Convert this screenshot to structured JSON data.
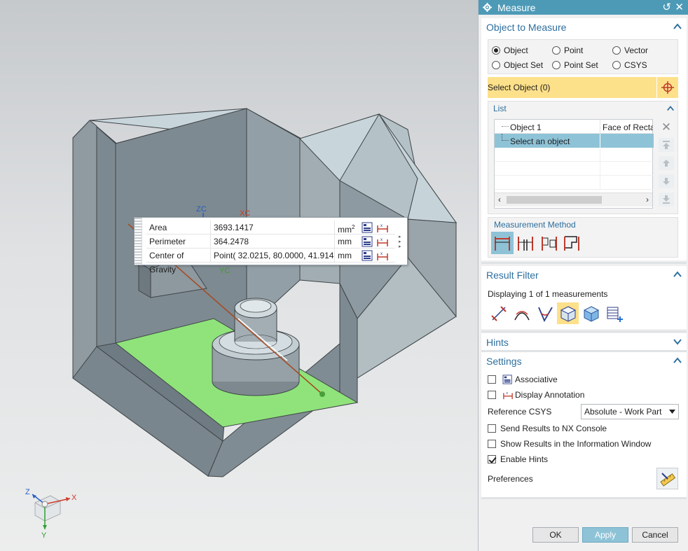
{
  "viewport": {
    "popup": {
      "rows": [
        {
          "label": "Area",
          "value": "3693.1417",
          "unit": "mm",
          "unit_sup": "2"
        },
        {
          "label": "Perimeter",
          "value": "364.2478",
          "unit": "mm",
          "unit_sup": ""
        },
        {
          "label": "Center of Gravity",
          "value": "Point( 32.0215, 80.0000, 41.9140)",
          "unit": "mm",
          "unit_sup": ""
        }
      ]
    },
    "axis_labels": {
      "zc": "ZC",
      "xc": "XC",
      "yc": "YC"
    },
    "triad": {
      "x": "X",
      "y": "Y",
      "z": "Z"
    },
    "colors": {
      "face_highlight": "#8fe37a",
      "part": "#8a969e",
      "part_top": "#c8d6dc"
    }
  },
  "dialog": {
    "title": "Measure",
    "object_to_measure": {
      "header": "Object to Measure",
      "options": [
        {
          "label": "Object",
          "selected": true
        },
        {
          "label": "Point",
          "selected": false
        },
        {
          "label": "Vector",
          "selected": false
        },
        {
          "label": "Object Set",
          "selected": false
        },
        {
          "label": "Point Set",
          "selected": false
        },
        {
          "label": "CSYS",
          "selected": false
        }
      ],
      "select_label": "Select Object (0)",
      "list": {
        "header": "List",
        "rows": [
          {
            "name": "Object 1",
            "type": "Face of Recta"
          },
          {
            "name": "Select an object",
            "type": ""
          }
        ]
      },
      "method_label": "Measurement Method"
    },
    "result_filter": {
      "header": "Result Filter",
      "displaying": "Displaying 1 of 1 measurements"
    },
    "hints": {
      "header": "Hints"
    },
    "settings": {
      "header": "Settings",
      "associative": "Associative",
      "display_annotation": "Display Annotation",
      "reference_csys_label": "Reference CSYS",
      "reference_csys_value": "Absolute - Work Part",
      "send_results": "Send Results to NX Console",
      "show_results": "Show Results in the Information Window",
      "enable_hints": "Enable Hints",
      "preferences": "Preferences"
    },
    "buttons": {
      "ok": "OK",
      "apply": "Apply",
      "cancel": "Cancel"
    },
    "accent": "#4d9ab7",
    "select_highlight": "#fde08a"
  }
}
